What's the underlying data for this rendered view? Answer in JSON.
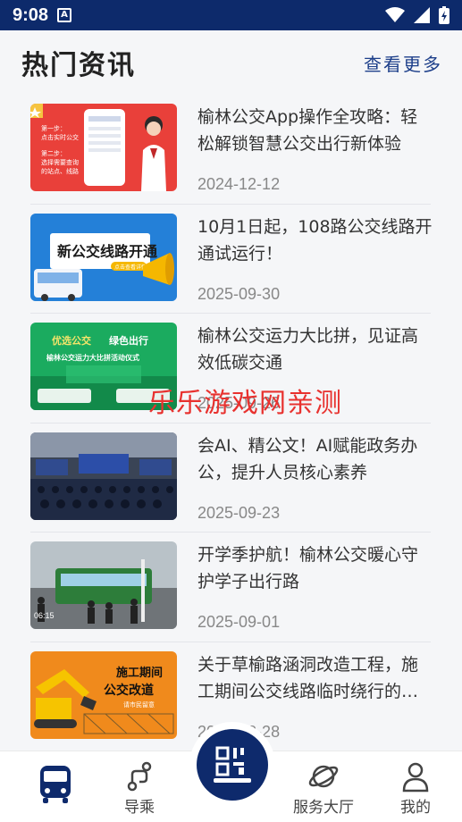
{
  "status_bar": {
    "time": "9:08",
    "badge": "A"
  },
  "header": {
    "title": "热门资讯",
    "more_link": "查看更多"
  },
  "news": [
    {
      "title": "榆林公交App操作全攻略：轻松解锁智慧公交出行新体验",
      "date": "2024-12-12",
      "thumb_text": [
        "第一步：",
        "点击实时公交",
        "第二步：",
        "选择需要查询",
        "的站点、线路"
      ]
    },
    {
      "title": "10月1日起，108路公交线路开通试运行！",
      "date": "2025-09-30",
      "thumb_text": [
        "新公交线路开通",
        "点击查看详情"
      ]
    },
    {
      "title": "榆林公交运力大比拼，见证高效低碳交通",
      "date": "2025-09-26",
      "thumb_text": [
        "优选公交",
        "绿色出行",
        "榆林公交运力大比拼活动仪式"
      ]
    },
    {
      "title": "会AI、精公文！AI赋能政务办公，提升人员核心素养",
      "date": "2025-09-23"
    },
    {
      "title": "开学季护航！榆林公交暖心守护学子出行路",
      "date": "2025-09-01",
      "thumb_text": [
        "06:15"
      ]
    },
    {
      "title": "关于草榆路涵洞改造工程，施工期间公交线路临时绕行的…",
      "date": "2025-08-28",
      "thumb_text": [
        "施工期间",
        "公交改道",
        "请市民留意"
      ]
    }
  ],
  "watermark": "乐乐游戏网亲测",
  "tab_bar": {
    "tabs": [
      {
        "label": "",
        "icon": "bus-icon"
      },
      {
        "label": "导乘",
        "icon": "route-icon"
      },
      {
        "label": "",
        "icon": "qr-scan-icon"
      },
      {
        "label": "服务大厅",
        "icon": "planet-icon"
      },
      {
        "label": "我的",
        "icon": "user-icon"
      }
    ],
    "active_color": "#0e2a6c"
  },
  "colors": {
    "status_bar": "#0d2a6b",
    "accent": "#1d3f8a",
    "watermark": "#e8322f"
  }
}
